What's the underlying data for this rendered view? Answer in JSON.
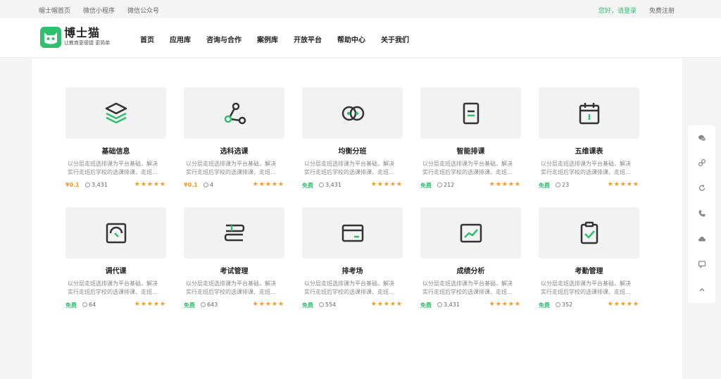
{
  "topbar": {
    "links": [
      "帽士帽首页",
      "微信小程序",
      "微信公众号"
    ],
    "login": "您好，请登录",
    "register": "免费注册"
  },
  "header": {
    "brand": "博士猫",
    "slogan": "让教育更便捷 更简单",
    "nav": [
      "首页",
      "应用库",
      "咨询与合作",
      "案例库",
      "开放平台",
      "帮助中心",
      "关于我们"
    ]
  },
  "desc_line1": "以分层走班选排课为平台基础，解决",
  "desc_line2": "实行走班后学校的选课排课、走班...",
  "stars": "★★★★★",
  "cards": [
    {
      "title": "基础信息",
      "price": "¥0.1",
      "views": "3,431",
      "icon": "layers-icon"
    },
    {
      "title": "选科选课",
      "price": "¥0.1",
      "views": "4",
      "icon": "share-nodes-icon"
    },
    {
      "title": "均衡分班",
      "price": "免费",
      "views": "3,431",
      "icon": "balance-circles-icon"
    },
    {
      "title": "智能排课",
      "price": "免费",
      "views": "212",
      "icon": "document-icon"
    },
    {
      "title": "五维课表",
      "price": "免费",
      "views": "23",
      "icon": "calendar-icon"
    },
    {
      "title": "调代课",
      "price": "免费",
      "views": "64",
      "icon": "gauge-icon"
    },
    {
      "title": "考试管理",
      "price": "免费",
      "views": "643",
      "icon": "books-icon"
    },
    {
      "title": "排考场",
      "price": "免费",
      "views": "554",
      "icon": "card-icon"
    },
    {
      "title": "成绩分析",
      "price": "免费",
      "views": "3,431",
      "icon": "chart-icon"
    },
    {
      "title": "考勤管理",
      "price": "免费",
      "views": "352",
      "icon": "clipboard-check-icon"
    }
  ],
  "colors": {
    "accent": "#2fbf6f",
    "price": "#f39a2b",
    "icon_dark": "#333333"
  }
}
